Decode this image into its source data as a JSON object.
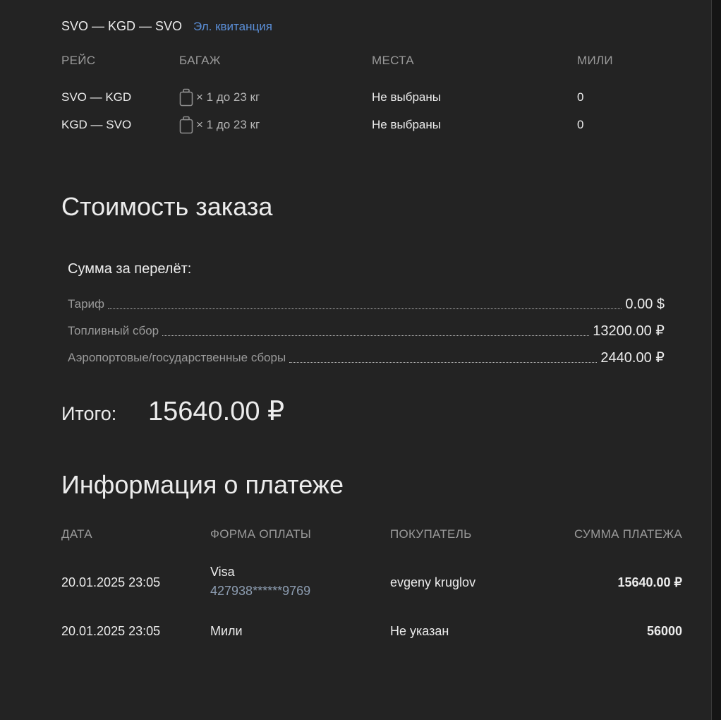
{
  "route": {
    "title": "SVO — KGD — SVO",
    "eticket_link": "Эл. квитанция"
  },
  "flights": {
    "headers": {
      "flight": "РЕЙС",
      "baggage": "БАГАЖ",
      "seats": "МЕСТА",
      "miles": "МИЛИ"
    },
    "rows": [
      {
        "flight": "SVO — KGD",
        "baggage": "× 1 до 23 кг",
        "baggage_icon": "luggage-icon",
        "seats": "Не выбраны",
        "miles": "0"
      },
      {
        "flight": "KGD — SVO",
        "baggage": "× 1 до 23 кг",
        "baggage_icon": "luggage-icon",
        "seats": "Не выбраны",
        "miles": "0"
      }
    ]
  },
  "cost": {
    "title": "Стоимость заказа",
    "subtitle": "Сумма за перелёт:",
    "items": [
      {
        "label": "Тариф",
        "value": "0.00 $"
      },
      {
        "label": "Топливный сбор",
        "value": "13200.00 ₽"
      },
      {
        "label": "Аэропортовые/государственные сборы",
        "value": "2440.00 ₽"
      }
    ],
    "total_label": "Итого:",
    "total_value": "15640.00 ₽"
  },
  "payment": {
    "title": "Информация о платеже",
    "headers": {
      "date": "ДАТА",
      "method": "ФОРМА ОПЛАТЫ",
      "buyer": "ПОКУПАТЕЛЬ",
      "amount": "СУММА ПЛАТЕЖА"
    },
    "rows": [
      {
        "date": "20.01.2025 23:05",
        "method": "Visa",
        "card": "427938******9769",
        "buyer": "evgeny kruglov",
        "amount": "15640.00 ₽"
      },
      {
        "date": "20.01.2025 23:05",
        "method": "Мили",
        "card": "",
        "buyer": "Не указан",
        "amount": "56000"
      }
    ]
  },
  "colors": {
    "background": "#232323",
    "link": "#5b8fd8",
    "muted": "#9a9a9a",
    "card_number": "#8c9cb0"
  }
}
